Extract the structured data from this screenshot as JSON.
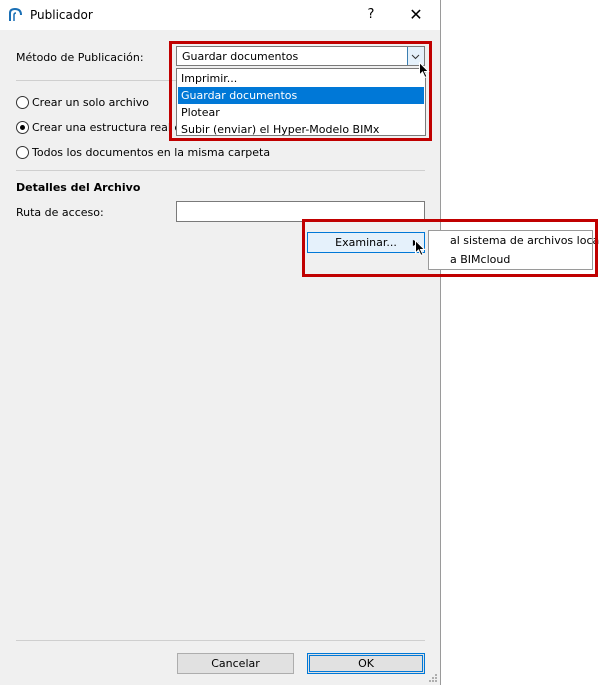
{
  "window": {
    "title": "Publicador",
    "help": "?",
    "close": "✕"
  },
  "method": {
    "label": "Método de Publicación:",
    "value": "Guardar documentos",
    "options": [
      "Imprimir...",
      "Guardar documentos",
      "Plotear",
      "Subir (enviar) el Hyper-Modelo BIMx"
    ]
  },
  "structure": {
    "opt1": "Crear un solo archivo",
    "opt2": "Crear una estructura real de",
    "opt3": "Todos los documentos en la misma carpeta"
  },
  "details": {
    "heading": "Detalles del Archivo",
    "path_label": "Ruta de acceso:",
    "path_value": "",
    "browse": "Examinar..."
  },
  "browse_menu": {
    "item1": "al sistema de archivos local",
    "item2": "a BIMcloud"
  },
  "footer": {
    "cancel": "Cancelar",
    "ok": "OK"
  },
  "colors": {
    "highlight": "#0078d7",
    "annotation": "#c00000"
  }
}
